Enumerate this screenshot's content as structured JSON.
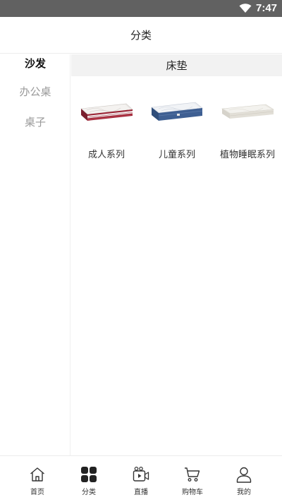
{
  "status_bar": {
    "time": "7:47",
    "wifi_icon": "wifi-icon"
  },
  "header": {
    "title": "分类"
  },
  "sidebar": {
    "items": [
      {
        "label": "沙发",
        "active": true
      },
      {
        "label": "办公桌",
        "active": false
      },
      {
        "label": "桌子",
        "active": false
      }
    ]
  },
  "main": {
    "section_title": "床垫",
    "products": [
      {
        "label": "成人系列",
        "icon": "mattress-red-trim"
      },
      {
        "label": "儿童系列",
        "icon": "mattress-blue"
      },
      {
        "label": "植物睡眠系列",
        "icon": "mattress-white"
      }
    ]
  },
  "tabbar": {
    "tabs": [
      {
        "label": "首页",
        "icon": "home-icon"
      },
      {
        "label": "分类",
        "icon": "category-grid-icon",
        "active": true
      },
      {
        "label": "直播",
        "icon": "live-video-icon"
      },
      {
        "label": "购物车",
        "icon": "cart-icon"
      },
      {
        "label": "我的",
        "icon": "user-icon"
      }
    ]
  }
}
